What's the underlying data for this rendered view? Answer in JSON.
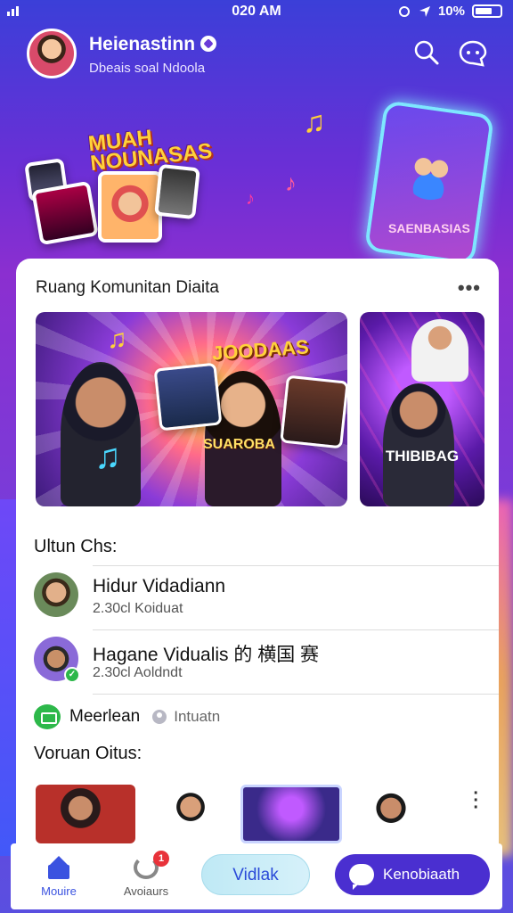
{
  "status_bar": {
    "time": "020 AM",
    "battery": "10%"
  },
  "header": {
    "user_name": "Heienastinn",
    "user_subtitle": "Dbeais soal Ndoola",
    "search_icon": "search-icon",
    "chat_icon": "chat-icon"
  },
  "hero": {
    "logo_text_1": "MUAH",
    "logo_text_2": "NOUNASAS",
    "phone_label": "SAENBASIAS"
  },
  "community": {
    "title": "Ruang Komunitan Diaita",
    "more": "•••",
    "banner_title": "JOODAAS",
    "banner_subtitle": "SUAROBA",
    "side_banner_label": "THIBIBAG"
  },
  "list": {
    "heading": "Ultun Chs:",
    "rows": [
      {
        "title": "Hidur Vidadiann",
        "subtitle": "2.30cl Koiduat"
      },
      {
        "title": "Hagane Vidualis 的 横国 赛",
        "subtitle": "2.30cl Aoldndt"
      }
    ],
    "tag_label": "Meerlean",
    "tag_sub": "Intuatn",
    "section2_heading": "Voruan Oitus:"
  },
  "bottom_nav": {
    "home_label": "Mouire",
    "activity_label": "Avoiaurs",
    "activity_badge": "1",
    "pill_light_label": "Vidlak",
    "pill_dark_label": "Kenobiaath"
  },
  "colors": {
    "accent": "#4a2fd0",
    "home_active": "#3a52e0",
    "badge_red": "#e8323a",
    "online_green": "#2db84a"
  }
}
